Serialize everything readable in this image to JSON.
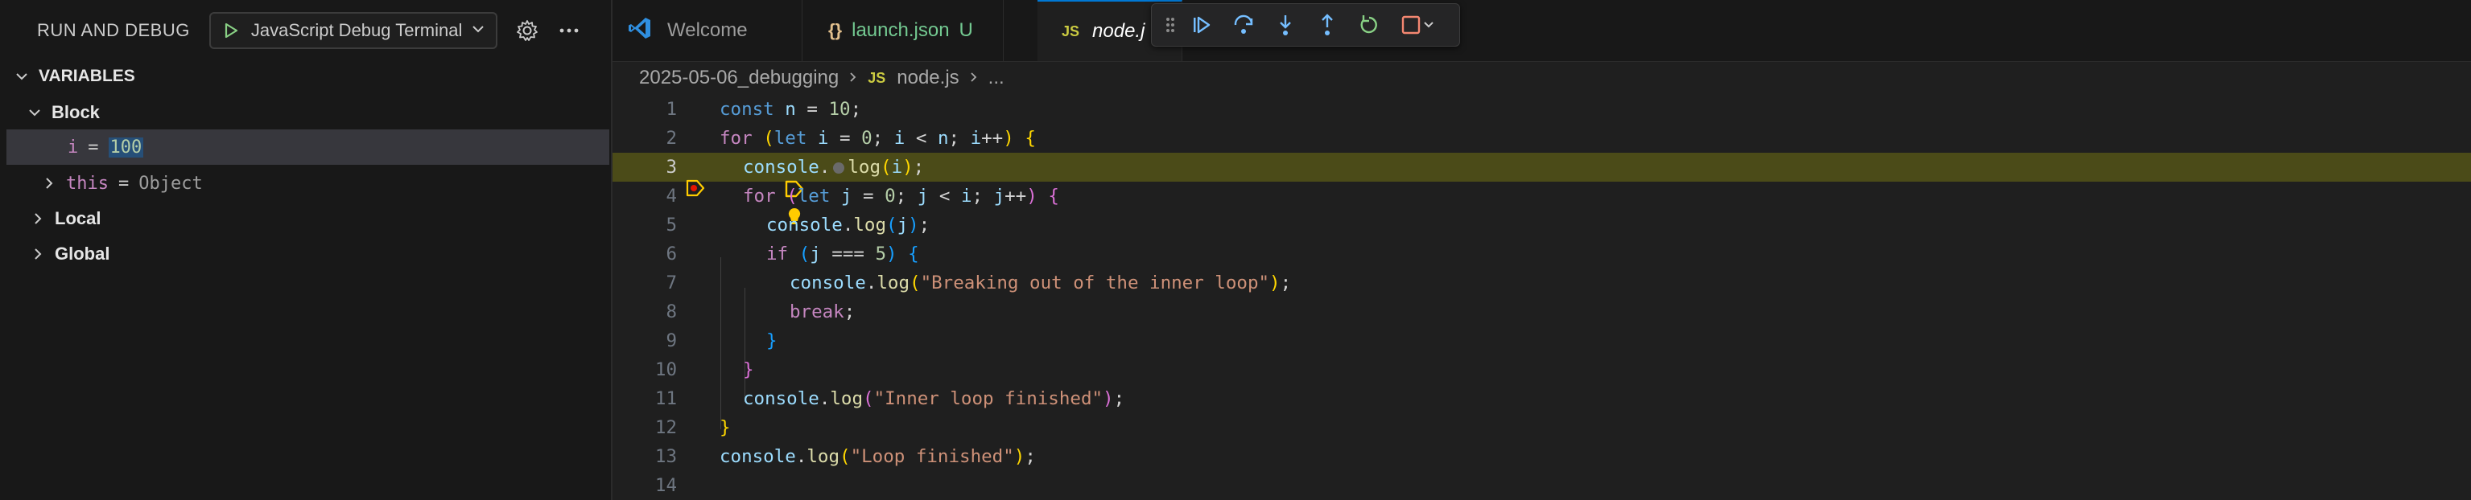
{
  "sidebar": {
    "title": "RUN AND DEBUG",
    "config_label": "JavaScript Debug Terminal",
    "variables_header": "VARIABLES",
    "scopes": {
      "block": "Block",
      "local": "Local",
      "global": "Global"
    },
    "block_vars": {
      "i_name": "i",
      "i_eq": "=",
      "i_value": "100",
      "this_name": "this",
      "this_eq": "=",
      "this_value": "Object"
    }
  },
  "tabs": [
    {
      "label": "Welcome"
    },
    {
      "label": "launch.json",
      "icon_text": "{}",
      "status": "U"
    },
    {
      "label": "node.j",
      "icon_text": "JS"
    }
  ],
  "breadcrumb": {
    "folder": "2025-05-06_debugging",
    "file_icon": "JS",
    "file": "node.js",
    "more": "..."
  },
  "debug_toolbar": {
    "icons": [
      "grip-icon",
      "continue-icon",
      "step-over-icon",
      "step-into-icon",
      "step-out-icon",
      "restart-icon",
      "stop-icon",
      "chevron-down-icon"
    ]
  },
  "editor": {
    "current_line": 3,
    "line_numbers": [
      "1",
      "2",
      "3",
      "4",
      "5",
      "6",
      "7",
      "8",
      "9",
      "10",
      "11",
      "12",
      "13",
      "14"
    ]
  },
  "colors": {
    "accent": "#0078d4",
    "current_line_bg": "#4b4b18",
    "breakpoint": "#ffcc00"
  }
}
